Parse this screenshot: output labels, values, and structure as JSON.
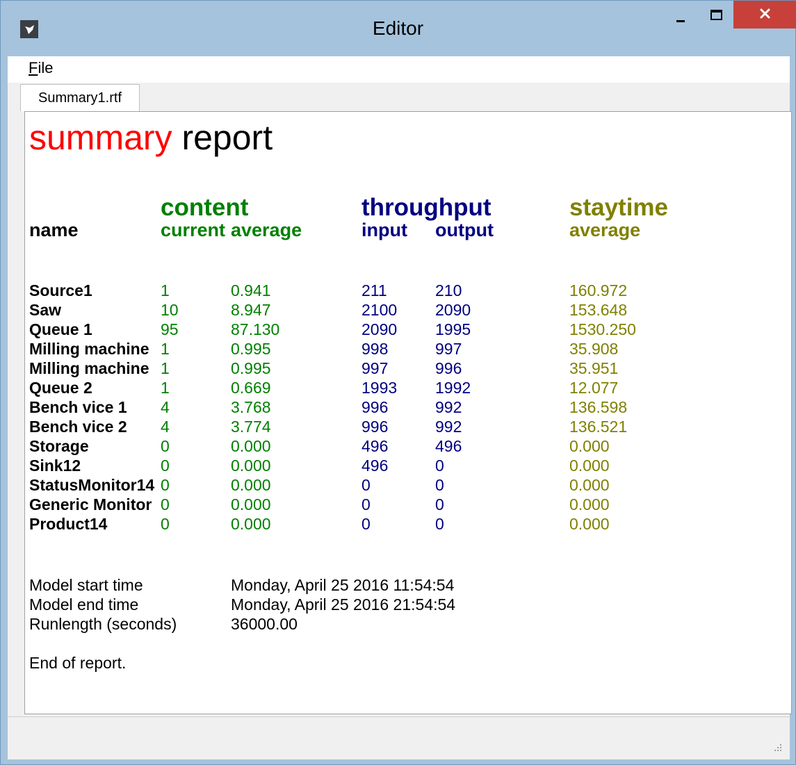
{
  "window": {
    "title": "Editor",
    "menu": {
      "file_label_first": "F",
      "file_label_rest": "ile"
    },
    "tab_label": "Summary1.rtf"
  },
  "report": {
    "title_red": "summary",
    "title_black": " report",
    "groups": {
      "content": "content",
      "throughput": "throughput",
      "staytime": "staytime"
    },
    "headers": {
      "name": "name",
      "current": "current",
      "average": "average",
      "input": "input",
      "output": "output",
      "stay_average": "average"
    },
    "rows": [
      {
        "name": "Source1",
        "current": "1",
        "average": "0.941",
        "input": "211",
        "output": "210",
        "staytime": "160.972"
      },
      {
        "name": "Saw",
        "current": "10",
        "average": "8.947",
        "input": "2100",
        "output": "2090",
        "staytime": "153.648"
      },
      {
        "name": "Queue 1",
        "current": "95",
        "average": "87.130",
        "input": "2090",
        "output": "1995",
        "staytime": "1530.250"
      },
      {
        "name": "Milling machine",
        "current": "1",
        "average": "0.995",
        "input": "998",
        "output": "997",
        "staytime": "35.908"
      },
      {
        "name": "Milling machine",
        "current": "1",
        "average": "0.995",
        "input": "997",
        "output": "996",
        "staytime": "35.951"
      },
      {
        "name": "Queue 2",
        "current": "1",
        "average": "0.669",
        "input": "1993",
        "output": "1992",
        "staytime": "12.077"
      },
      {
        "name": "Bench vice 1",
        "current": "4",
        "average": "3.768",
        "input": "996",
        "output": "992",
        "staytime": "136.598"
      },
      {
        "name": "Bench vice 2",
        "current": "4",
        "average": "3.774",
        "input": "996",
        "output": "992",
        "staytime": "136.521"
      },
      {
        "name": "Storage",
        "current": "0",
        "average": "0.000",
        "input": "496",
        "output": "496",
        "staytime": "0.000"
      },
      {
        "name": "Sink12",
        "current": "0",
        "average": "0.000",
        "input": "496",
        "output": "0",
        "staytime": "0.000"
      },
      {
        "name": "StatusMonitor14",
        "current": "0",
        "average": "0.000",
        "input": "0",
        "output": "0",
        "staytime": "0.000"
      },
      {
        "name": "Generic Monitor",
        "current": "0",
        "average": "0.000",
        "input": "0",
        "output": "0",
        "staytime": "0.000"
      },
      {
        "name": "Product14",
        "current": "0",
        "average": "0.000",
        "input": "0",
        "output": "0",
        "staytime": "0.000"
      }
    ],
    "footer": {
      "start_label": "Model start time",
      "start_value": "Monday, April 25 2016 11:54:54",
      "end_label": "Model end  time",
      "end_value": "Monday, April 25 2016 21:54:54",
      "run_label": "Runlength (seconds)",
      "run_value": "36000.00",
      "end_note": "End of report."
    }
  },
  "colors": {
    "red": "#ff0000",
    "green": "#008000",
    "navy": "#000080",
    "olive": "#808000",
    "close_button": "#c7403a",
    "frame": "#a5c3dc"
  }
}
